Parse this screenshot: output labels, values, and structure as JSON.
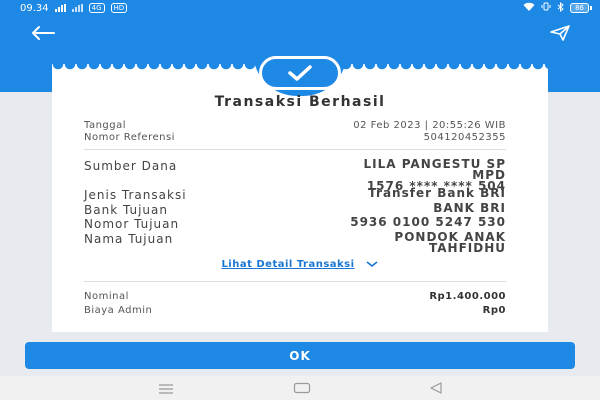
{
  "status_bar": {
    "time": "09.34",
    "left_indicators": [
      "4G",
      "HD"
    ],
    "battery": "86"
  },
  "app_bar": {
    "back_icon": "arrow-left-icon",
    "share_icon": "send-icon"
  },
  "receipt": {
    "status_icon": "check-icon",
    "title": "Transaksi Berhasil",
    "meta": [
      {
        "label": "Tanggal",
        "value": "02 Feb 2023 | 20:55:26 WIB"
      },
      {
        "label": "Nomor Referensi",
        "value": "504120452355"
      }
    ],
    "details": [
      {
        "label": "Sumber Dana",
        "value_lines": [
          "LILA PANGESTU SP",
          "MPD",
          "1576 **** **** 504"
        ]
      },
      {
        "label": "Jenis Transaksi",
        "value_lines": [
          "Transfer Bank BRI"
        ]
      },
      {
        "label": "Bank Tujuan",
        "value_lines": [
          "BANK BRI"
        ]
      },
      {
        "label": "Nomor Tujuan",
        "value_lines": [
          "5936 0100 5247 530"
        ]
      },
      {
        "label": "Nama Tujuan",
        "value_lines": [
          "PONDOK ANAK",
          "TAHFIDHU"
        ]
      }
    ],
    "detail_link": "Lihat Detail Transaksi",
    "summary": [
      {
        "label": "Nominal",
        "value": "Rp1.400.000"
      },
      {
        "label": "Biaya Admin",
        "value": "Rp0"
      }
    ]
  },
  "ok_button": "OK",
  "nav_bar": {
    "items": [
      "menu-icon",
      "home-icon",
      "back-icon"
    ]
  },
  "colors": {
    "primary": "#1e88e5",
    "link": "#1976d2",
    "background": "#e7ebef"
  }
}
